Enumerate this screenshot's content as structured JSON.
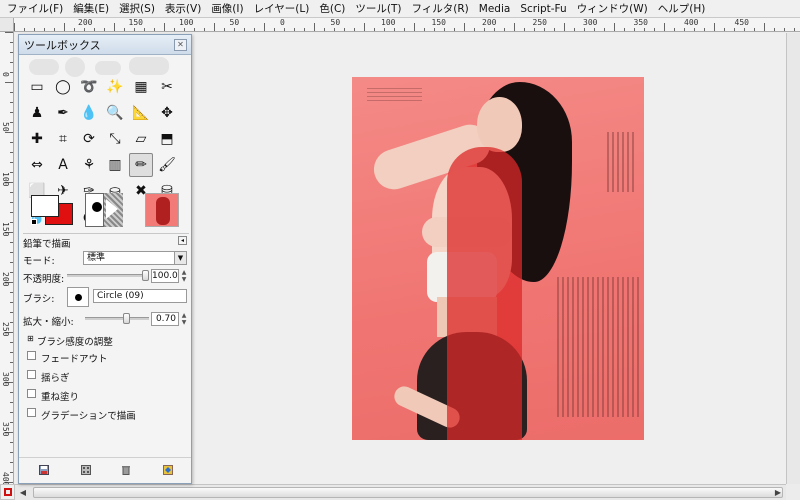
{
  "menu": [
    "ファイル(F)",
    "編集(E)",
    "選択(S)",
    "表示(V)",
    "画像(I)",
    "レイヤー(L)",
    "色(C)",
    "ツール(T)",
    "フィルタ(R)",
    "Media",
    "Script-Fu",
    "ウィンドウ(W)",
    "ヘルプ(H)"
  ],
  "ruler": {
    "top_labels": [
      "200",
      "150",
      "100",
      "50",
      "0",
      "50",
      "100",
      "150",
      "200",
      "250",
      "300",
      "350",
      "400",
      "450"
    ],
    "left_labels": [
      "0",
      "50",
      "100",
      "150",
      "200",
      "250",
      "300",
      "350",
      "400"
    ]
  },
  "toolbox": {
    "title": "ツールボックス",
    "tools": [
      {
        "name": "rect-select-icon",
        "glyph": "▭"
      },
      {
        "name": "ellipse-select-icon",
        "glyph": "◯"
      },
      {
        "name": "lasso-icon",
        "glyph": "➰"
      },
      {
        "name": "fuzzy-select-icon",
        "glyph": "✨"
      },
      {
        "name": "color-select-icon",
        "glyph": "▦"
      },
      {
        "name": "scissors-icon",
        "glyph": "✂"
      },
      {
        "name": "foreground-select-icon",
        "glyph": "♟"
      },
      {
        "name": "paths-icon",
        "glyph": "✒"
      },
      {
        "name": "color-picker-icon",
        "glyph": "💧"
      },
      {
        "name": "zoom-icon",
        "glyph": "🔍"
      },
      {
        "name": "measure-icon",
        "glyph": "📐"
      },
      {
        "name": "move-icon",
        "glyph": "✥"
      },
      {
        "name": "align-icon",
        "glyph": "✚"
      },
      {
        "name": "crop-icon",
        "glyph": "⌗"
      },
      {
        "name": "rotate-icon",
        "glyph": "⟳"
      },
      {
        "name": "scale-icon",
        "glyph": "⤡"
      },
      {
        "name": "shear-icon",
        "glyph": "▱"
      },
      {
        "name": "perspective-icon",
        "glyph": "⬒"
      },
      {
        "name": "flip-icon",
        "glyph": "⇔"
      },
      {
        "name": "text-icon",
        "glyph": "A"
      },
      {
        "name": "clone-icon",
        "glyph": "⚘"
      },
      {
        "name": "blend-icon",
        "glyph": "▥"
      },
      {
        "name": "pencil-icon",
        "glyph": "✏"
      },
      {
        "name": "paintbrush-icon",
        "glyph": "🖌"
      },
      {
        "name": "eraser-icon",
        "glyph": "⬜"
      },
      {
        "name": "airbrush-icon",
        "glyph": "✈"
      },
      {
        "name": "ink-icon",
        "glyph": "✑"
      },
      {
        "name": "stamp-icon",
        "glyph": "⛀"
      },
      {
        "name": "heal-icon",
        "glyph": "✖"
      },
      {
        "name": "perspective-clone-icon",
        "glyph": "⛁"
      },
      {
        "name": "blur-icon",
        "glyph": "💧"
      },
      {
        "name": "smudge-icon",
        "glyph": "☝"
      },
      {
        "name": "dodge-burn-icon",
        "glyph": "●"
      }
    ],
    "active_tool_index": 22,
    "colors": {
      "foreground": "#ffffff",
      "background": "#e01010"
    },
    "options": {
      "title": "鉛筆で描画",
      "mode_label": "モード:",
      "mode_value": "標準",
      "opacity_label": "不透明度:",
      "opacity_value": "100.0",
      "opacity_fraction": 1.0,
      "brush_label": "ブラシ:",
      "brush_name": "Circle (09)",
      "scale_label": "拡大・縮小:",
      "scale_value": "0.70",
      "scale_fraction": 0.7,
      "dynamics_label": "ブラシ感度の調整",
      "checks": [
        "フェードアウト",
        "揺らぎ",
        "重ね塗り",
        "グラデーションで描画"
      ]
    }
  },
  "canvas": {
    "background": "#f27b78"
  }
}
